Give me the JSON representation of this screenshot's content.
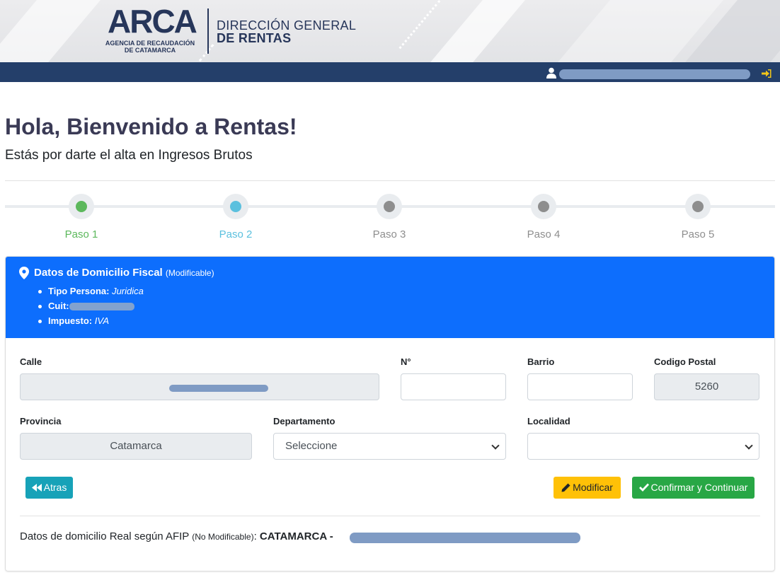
{
  "header": {
    "logo_text": "ARCA",
    "logo_subtitle": "AGENCIA DE RECAUDACIÓN DE CATAMARCA",
    "agency_line1": "DIRECCIÓN GENERAL",
    "agency_line2": "DE RENTAS",
    "user_icon": "user-icon",
    "logout_icon": "sign-in-icon"
  },
  "page": {
    "title": "Hola, Bienvenido a Rentas!",
    "subtitle": "Estás por darte el alta en Ingresos Brutos"
  },
  "stepper": {
    "steps": [
      {
        "label": "Paso 1",
        "state": "completed",
        "color": "#5cb85c"
      },
      {
        "label": "Paso 2",
        "state": "current",
        "color": "#5bc0de"
      },
      {
        "label": "Paso 3",
        "state": "pending",
        "color": "#8e8e8e"
      },
      {
        "label": "Paso 4",
        "state": "pending",
        "color": "#8e8e8e"
      },
      {
        "label": "Paso 5",
        "state": "pending",
        "color": "#8e8e8e"
      }
    ]
  },
  "card": {
    "header_title": "Datos de Domicilio Fiscal",
    "header_note": "(Modificable)",
    "header_icon": "map-marker-icon",
    "tipo_persona_label": "Tipo Persona:",
    "tipo_persona_value": "Juridica",
    "cuit_label": "Cuit:",
    "impuesto_label": "Impuesto:",
    "impuesto_value": "IVA"
  },
  "form": {
    "calle_label": "Calle",
    "numero_label": "N°",
    "numero_value": "",
    "barrio_label": "Barrio",
    "barrio_value": "",
    "cp_label": "Codigo Postal",
    "cp_value": "5260",
    "provincia_label": "Provincia",
    "provincia_value": "Catamarca",
    "departamento_label": "Departamento",
    "departamento_value": "Seleccione",
    "localidad_label": "Localidad",
    "localidad_value": ""
  },
  "buttons": {
    "back_label": "Atras",
    "modify_label": "Modificar",
    "confirm_label": "Confirmar y Continuar"
  },
  "footer": {
    "real_text": "Datos de domicilio Real según AFIP",
    "real_note": "(No Modificable)",
    "real_value": "CATAMARCA -"
  },
  "colors": {
    "navbar": "#243f6a",
    "card_header": "#0d6efd",
    "back_button": "#17a2b8",
    "modify_button": "#ffc107",
    "confirm_button": "#28a745"
  }
}
